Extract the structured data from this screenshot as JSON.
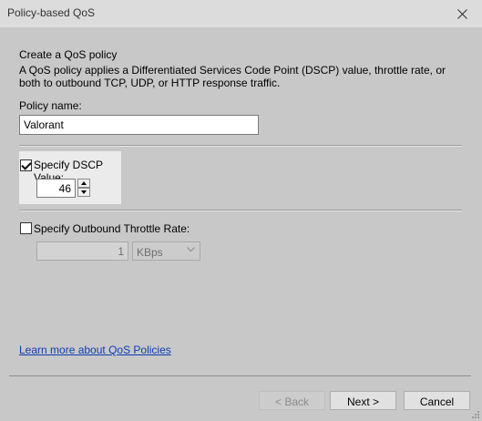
{
  "window": {
    "title": "Policy-based QoS"
  },
  "page": {
    "heading": "Create a QoS policy",
    "description": "A QoS policy applies a Differentiated Services Code Point (DSCP) value, throttle rate, or both to outbound TCP, UDP, or HTTP response traffic."
  },
  "policy_name": {
    "label": "Policy name:",
    "value": "Valorant"
  },
  "dscp": {
    "label": "Specify DSCP Value:",
    "checked": true,
    "value": "46"
  },
  "throttle": {
    "label": "Specify Outbound Throttle Rate:",
    "checked": false,
    "value": "1",
    "unit": "KBps"
  },
  "link": {
    "text": "Learn more about QoS Policies"
  },
  "buttons": {
    "back": "< Back",
    "next": "Next >",
    "cancel": "Cancel"
  },
  "icons": {
    "close": "close-icon",
    "spin_up": "arrow-up-icon",
    "spin_down": "arrow-down-icon",
    "dropdown": "chevron-down-icon",
    "checkmark": "checkmark-icon"
  }
}
